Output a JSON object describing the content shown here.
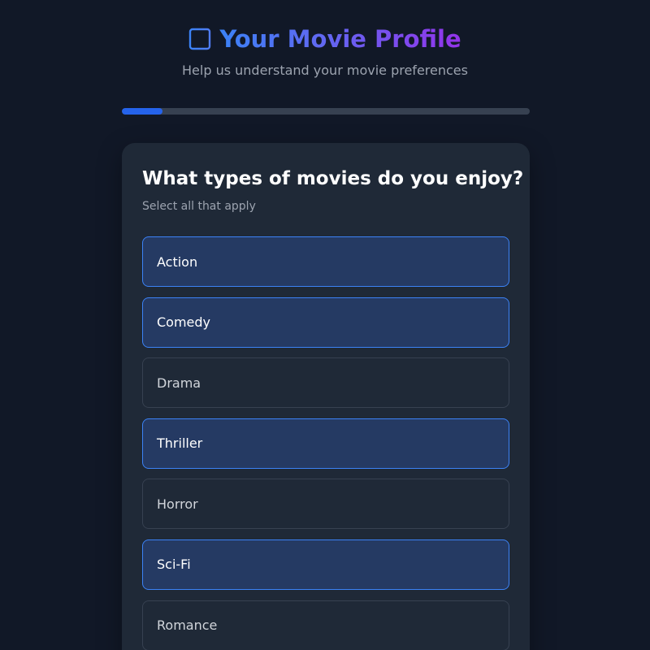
{
  "header": {
    "icon": "film-icon",
    "title": "Your Movie Profile",
    "subtitle": "Help us understand your movie preferences"
  },
  "progress": {
    "value_percent": 10
  },
  "colors": {
    "background": "#111827",
    "card": "#1f2937",
    "accent": "#3b82f6",
    "selected_bg": "#253a63",
    "title_gradient_start": "#3b82f6",
    "title_gradient_end": "#9333ea"
  },
  "question": {
    "title": "What types of movies do you enjoy?",
    "hint": "Select all that apply"
  },
  "options": [
    {
      "label": "Action",
      "selected": true
    },
    {
      "label": "Comedy",
      "selected": true
    },
    {
      "label": "Drama",
      "selected": false
    },
    {
      "label": "Thriller",
      "selected": true
    },
    {
      "label": "Horror",
      "selected": false
    },
    {
      "label": "Sci-Fi",
      "selected": true
    },
    {
      "label": "Romance",
      "selected": false
    }
  ]
}
